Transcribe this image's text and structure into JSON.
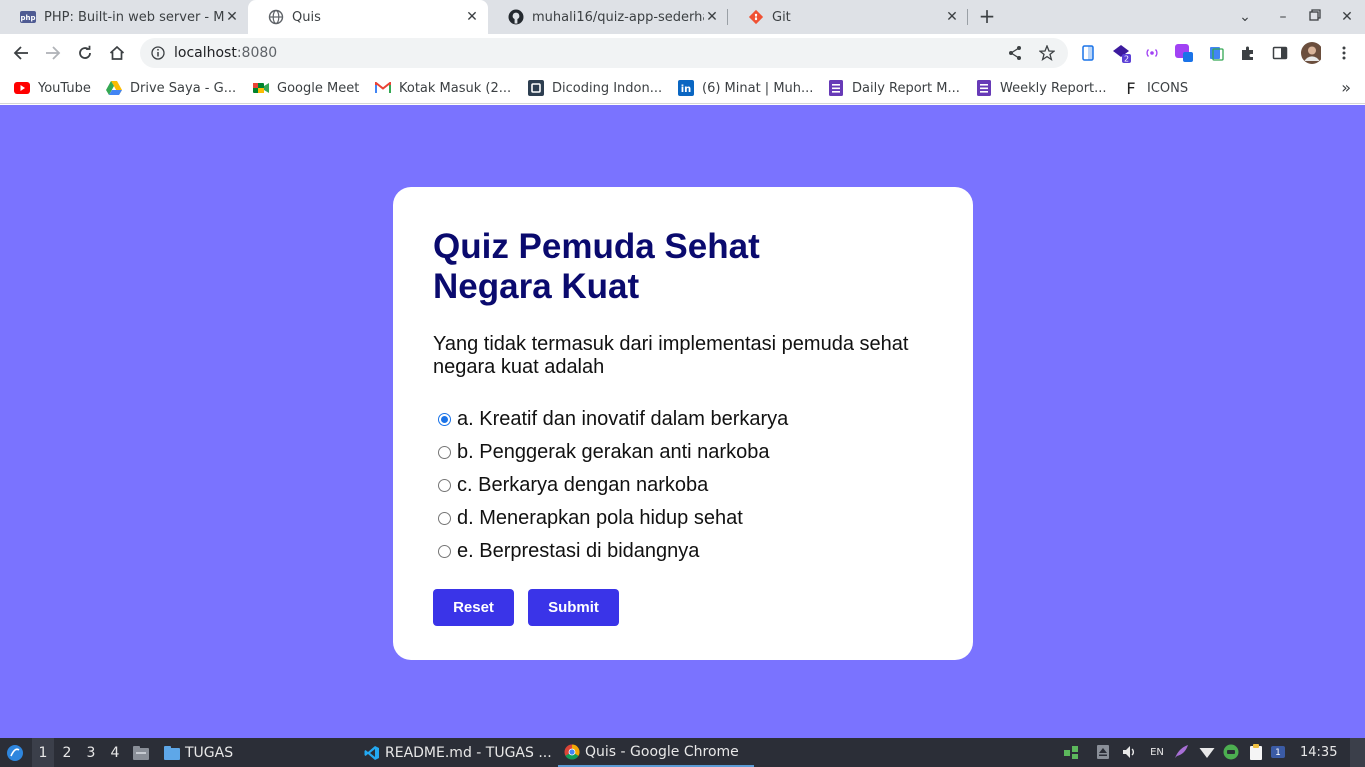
{
  "tabs": [
    {
      "title": "PHP: Built-in web server - Manual",
      "icon": "php-icon",
      "active": false
    },
    {
      "title": "Quis",
      "icon": "globe-icon",
      "active": true
    },
    {
      "title": "muhali16/quiz-app-sederhana",
      "icon": "github-icon",
      "active": false
    },
    {
      "title": "Git",
      "icon": "git-icon",
      "active": false
    }
  ],
  "new_tab_label": "+",
  "address": {
    "host": "localhost",
    "port": ":8080"
  },
  "bookmarks": [
    {
      "label": "YouTube",
      "icon": "youtube-icon"
    },
    {
      "label": "Drive Saya - G...",
      "icon": "google-drive-icon"
    },
    {
      "label": "Google Meet",
      "icon": "google-meet-icon"
    },
    {
      "label": "Kotak Masuk (2...",
      "icon": "gmail-icon"
    },
    {
      "label": "Dicoding Indon...",
      "icon": "dicoding-icon"
    },
    {
      "label": "(6) Minat | Muh...",
      "icon": "linkedin-icon"
    },
    {
      "label": "Daily Report M...",
      "icon": "forms-icon"
    },
    {
      "label": "Weekly Report...",
      "icon": "forms-icon"
    },
    {
      "label": "ICONS",
      "icon": "letter-f-icon"
    }
  ],
  "bookmarks_more": "»",
  "extension_badge": "2",
  "quiz": {
    "title": "Quiz Pemuda Sehat Negara Kuat",
    "question": "Yang tidak termasuk dari implementasi pemuda sehat negara kuat adalah",
    "options": [
      {
        "label": "a. Kreatif dan inovatif dalam berkarya",
        "checked": true
      },
      {
        "label": "b. Penggerak gerakan anti narkoba",
        "checked": false
      },
      {
        "label": "c. Berkarya dengan narkoba",
        "checked": false
      },
      {
        "label": "d. Menerapkan pola hidup sehat",
        "checked": false
      },
      {
        "label": "e. Berprestasi di bidangnya",
        "checked": false
      }
    ],
    "reset_label": "Reset",
    "submit_label": "Submit"
  },
  "colors": {
    "page_background": "#7a73ff",
    "title_color": "#0a0a6e",
    "button_color": "#3a34e8",
    "radio_checked": "#1a73e8"
  },
  "taskbar": {
    "workspaces": [
      "1",
      "2",
      "3",
      "4"
    ],
    "folder_label": "TUGAS",
    "apps": [
      {
        "label": "README.md - TUGAS ...",
        "icon": "vscode-icon"
      },
      {
        "label": "Quis - Google Chrome",
        "icon": "chrome-icon"
      }
    ],
    "lang": "EN",
    "notif_count": "1",
    "clock": "14:35"
  }
}
